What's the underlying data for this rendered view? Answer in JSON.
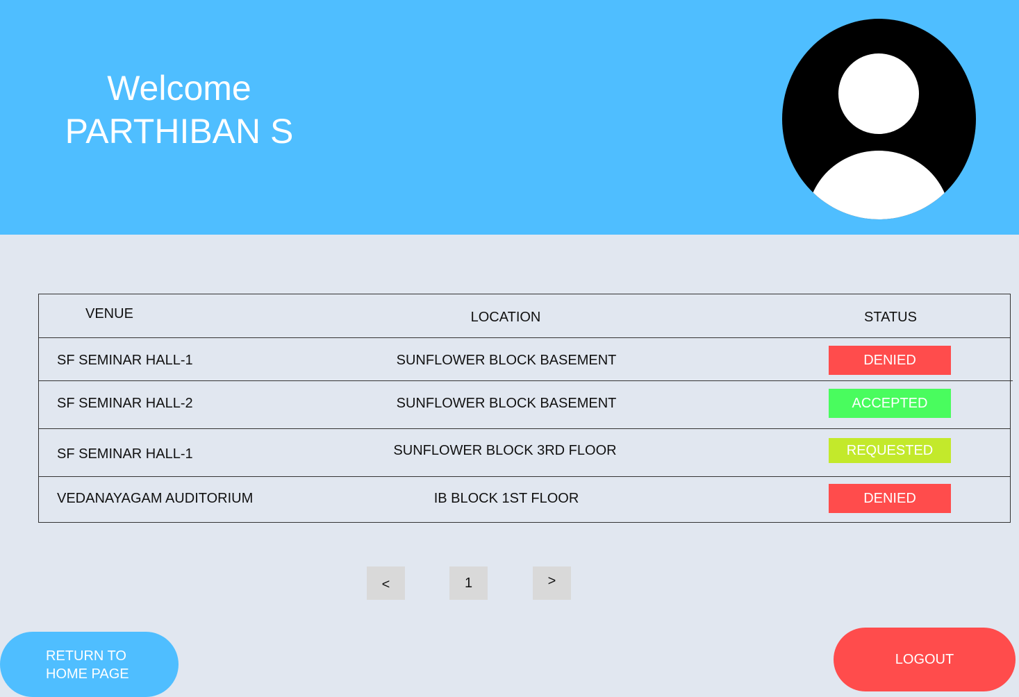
{
  "header": {
    "greeting": "Welcome",
    "user_name": "PARTHIBAN S",
    "avatar_icon": "user-avatar-icon"
  },
  "table": {
    "columns": [
      "VENUE",
      "LOCATION",
      "STATUS"
    ],
    "rows": [
      {
        "venue": "SF SEMINAR HALL-1",
        "location": "SUNFLOWER BLOCK BASEMENT",
        "status": "DENIED"
      },
      {
        "venue": "SF SEMINAR HALL-2",
        "location": "SUNFLOWER BLOCK BASEMENT",
        "status": "ACCEPTED"
      },
      {
        "venue": "SF SEMINAR HALL-1",
        "location": "SUNFLOWER BLOCK 3RD FLOOR",
        "status": "REQUESTED"
      },
      {
        "venue": "VEDANAYAGAM AUDITORIUM",
        "location": "IB BLOCK 1ST FLOOR",
        "status": "DENIED"
      }
    ]
  },
  "pagination": {
    "prev": "<",
    "current": "1",
    "next": ">"
  },
  "buttons": {
    "home_line1": "RETURN TO",
    "home_line2": "HOME PAGE",
    "logout": "LOGOUT"
  },
  "colors": {
    "header_bg": "#4fbeff",
    "page_bg": "#e1e7f0",
    "denied": "#ff4c4c",
    "accepted": "#49fc5e",
    "requested": "#c3e92b"
  }
}
